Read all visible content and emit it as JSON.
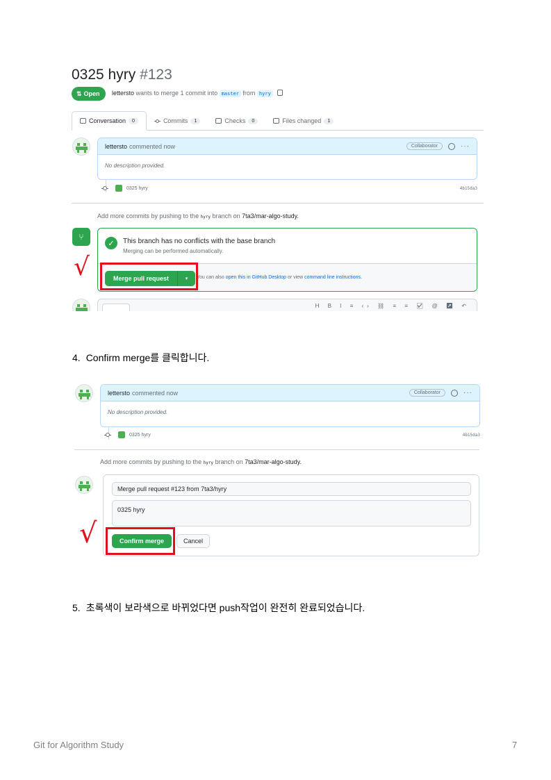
{
  "screenshot1": {
    "pr_title": "0325 hyry",
    "pr_number": "#123",
    "state": "Open",
    "meta": {
      "author": "lettersto",
      "text1": "wants to merge 1 commit into",
      "base_branch": "master",
      "text2": "from",
      "head_branch": "hyry"
    },
    "tabs": [
      {
        "label": "Conversation",
        "count": "0"
      },
      {
        "label": "Commits",
        "count": "1"
      },
      {
        "label": "Checks",
        "count": "0"
      },
      {
        "label": "Files changed",
        "count": "1"
      }
    ],
    "comment": {
      "author": "lettersto",
      "action": "commented now",
      "role": "Collaborator",
      "body": "No description provided."
    },
    "commit": {
      "message": "0325 hyry",
      "sha": "4b15da3"
    },
    "more_commits": {
      "prefix": "Add more commits by pushing to the",
      "branch": "hyry",
      "middle": "branch on",
      "repo": "7ta3/mar-algo-study."
    },
    "merge_box": {
      "title": "This branch has no conflicts with the base branch",
      "subtitle": "Merging can be performed automatically.",
      "button": "Merge pull request",
      "alt_prefix": "You can also",
      "alt_link1": "open this in GitHub Desktop",
      "alt_mid": "or view",
      "alt_link2": "command line instructions."
    },
    "checkmark": "√"
  },
  "step4": {
    "number": "4.",
    "text": "Confirm merge를 클릭합니다."
  },
  "screenshot2": {
    "comment": {
      "author": "lettersto",
      "action": "commented now",
      "role": "Collaborator",
      "body": "No description provided."
    },
    "commit": {
      "message": "0325 hyry",
      "sha": "4b15da3"
    },
    "more_commits": {
      "prefix": "Add more commits by pushing to the",
      "branch": "hyry",
      "middle": "branch on",
      "repo": "7ta3/mar-algo-study."
    },
    "merge_title_value": "Merge pull request #123 from 7ta3/hyry",
    "merge_message_value": "0325 hyry",
    "confirm_button": "Confirm merge",
    "cancel_button": "Cancel",
    "checkmark": "√"
  },
  "step5": {
    "number": "5.",
    "text": "초록색이 보라색으로 바뀌었다면 push작업이 완전히 완료되었습니다."
  },
  "footer": {
    "title": "Git for Algorithm Study",
    "page": "7"
  }
}
